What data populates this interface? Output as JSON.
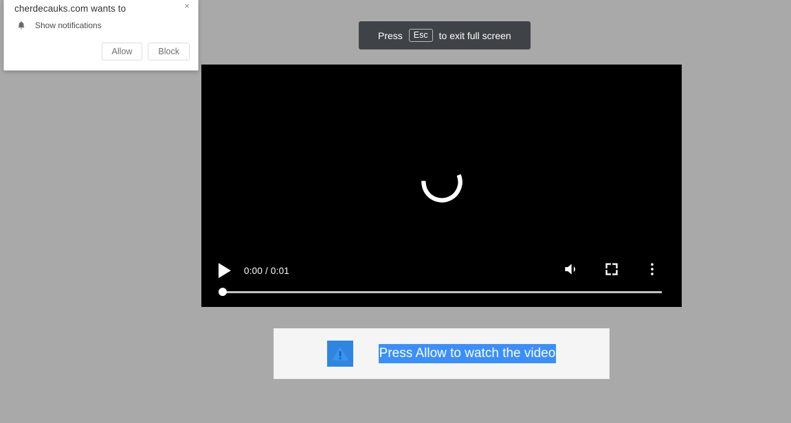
{
  "page": {
    "background_color": "#a9a9a9"
  },
  "permission_dialog": {
    "title": "cherdecauks.com wants to",
    "permission_label": "Show notifications",
    "bell_icon": "bell-icon",
    "close_icon": "×",
    "allow_label": "Allow",
    "block_label": "Block"
  },
  "fullscreen_toast": {
    "prefix": "Press",
    "key": "Esc",
    "suffix": "to exit full screen",
    "background_color": "#3f4347"
  },
  "video_player": {
    "state": "loading",
    "spinner_icon": "loading-spinner-icon",
    "play_icon": "play-icon",
    "time_label": "0:00 / 0:01",
    "current_time": "0:00",
    "duration": "0:01",
    "progress_percent": 0,
    "volume_icon": "volume-icon",
    "fullscreen_icon": "fullscreen-icon",
    "more_options_icon": "more-vertical-icon"
  },
  "cta_banner": {
    "icon": "warning-triangle-icon",
    "message": "Press Allow to watch the video",
    "selection_color": "#3b8ffc",
    "icon_background": "#2f86e0"
  }
}
